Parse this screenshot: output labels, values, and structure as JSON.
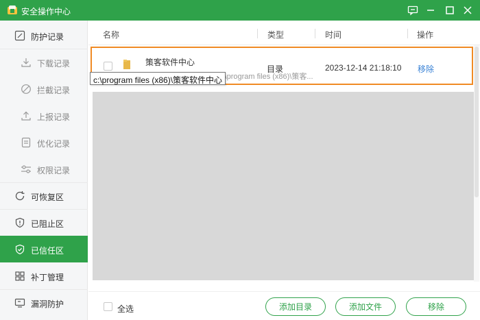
{
  "window": {
    "title": "安全操作中心",
    "buttons": [
      "feedback-icon",
      "minimize-icon",
      "maximize-icon",
      "close-icon"
    ]
  },
  "colors": {
    "brand_green": "#2fa24a",
    "highlight_orange": "#f08a24",
    "link_blue": "#3a83d6"
  },
  "sidebar": {
    "items": [
      {
        "label": "防护记录",
        "icon": "edit-icon"
      },
      {
        "label": "下载记录",
        "icon": "download-icon"
      },
      {
        "label": "拦截记录",
        "icon": "block-icon"
      },
      {
        "label": "上报记录",
        "icon": "upload-icon"
      },
      {
        "label": "优化记录",
        "icon": "document-icon"
      },
      {
        "label": "权限记录",
        "icon": "sliders-icon"
      },
      {
        "label": "可恢复区",
        "icon": "restore-icon"
      },
      {
        "label": "已阻止区",
        "icon": "shield-alert-icon"
      },
      {
        "label": "已信任区",
        "icon": "shield-check-icon"
      },
      {
        "label": "补丁管理",
        "icon": "grid-icon"
      },
      {
        "label": "漏洞防护",
        "icon": "monitor-icon"
      }
    ],
    "active": "已信任区"
  },
  "table": {
    "headers": {
      "name": "名称",
      "type": "类型",
      "time": "时间",
      "action": "操作"
    },
    "rows": [
      {
        "name": "策客软件中心",
        "path": "c:\\program files (x86)\\策客...",
        "type": "目录",
        "time": "2023-12-14 21:18:10",
        "action": "移除"
      }
    ]
  },
  "tooltip": "c:\\program files (x86)\\策客软件中心",
  "footer": {
    "select_all": "全选",
    "add_dir": "添加目录",
    "add_file": "添加文件",
    "remove": "移除"
  }
}
